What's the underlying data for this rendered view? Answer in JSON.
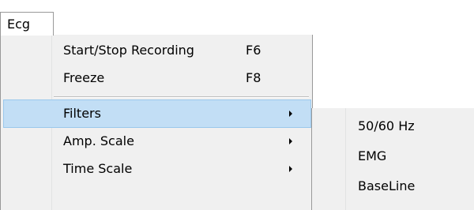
{
  "menubar": {
    "title": "Ecg"
  },
  "menu": {
    "items": [
      {
        "label": "Start/Stop Recording",
        "shortcut": "F6"
      },
      {
        "label": "Freeze",
        "shortcut": "F8"
      },
      {
        "label": "Filters",
        "submenu": true,
        "highlighted": true
      },
      {
        "label": "Amp. Scale",
        "submenu": true
      },
      {
        "label": "Time Scale",
        "submenu": true
      }
    ]
  },
  "submenu": {
    "items": [
      {
        "label": "50/60 Hz"
      },
      {
        "label": "EMG"
      },
      {
        "label": "BaseLine"
      }
    ]
  },
  "colors": {
    "menu_background": "#f0f0f0",
    "highlight_fill": "#c2def5",
    "highlight_border": "#9ac8ec",
    "border": "#999999"
  }
}
